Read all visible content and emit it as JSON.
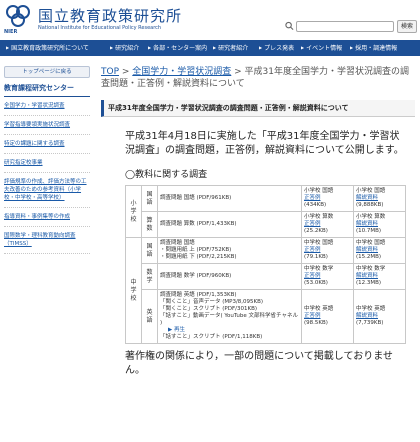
{
  "header": {
    "title": "国立教育政策研究所",
    "subtitle": "National Institute for Educational Policy Research",
    "nier": "NIER",
    "search_button": "検索"
  },
  "nav": [
    "国立教育政策研究所について",
    "研究紹介",
    "各部・センター案内",
    "研究者紹介",
    "プレス発表",
    "イベント情報",
    "採用・調達情報"
  ],
  "sidebar": {
    "top_button": "トップページに戻る",
    "title": "教育課程研究センター",
    "items": [
      "全国学力・学習状況調査",
      "学習指導要領実施状況調査",
      "特定の課題に関する調査",
      "研究指定校事業",
      "評価規準の作成、評価方法等の工夫改善のための参考資料（小学校・中学校・高等学校）",
      "指導資料・事例集等の作成",
      "国際数学・理科教育動向調査（TIMSS）"
    ]
  },
  "breadcrumb": {
    "top": "TOP",
    "sep": " > ",
    "parent": "全国学力・学習状況調査",
    "current": " > 平成31年度全国学力・学習状況調査の調査問題・正答例・解説資料について"
  },
  "page_heading": "平成31年度全国学力・学習状況調査の調査問題・正答例・解説資料について",
  "intro": "平成31年4月18日に実施した「平成31年度全国学力・学習状況調査」の調査問題，正答例，解説資料について公開します。",
  "section_heading": "◯教科に関する調査",
  "table": {
    "elementary": "小学校",
    "junior": "中学校",
    "rows": [
      {
        "subject": "国語",
        "lines": [
          "調査問題 国語 (PDF/961KB)"
        ],
        "answer": [
          "小学校 国語",
          "正答例",
          "(434KB)"
        ],
        "guide": [
          "小学校 国語",
          "解説資料",
          "(9,888KB)"
        ]
      },
      {
        "subject": "算数",
        "lines": [
          "調査問題 算数 (PDF/1,433KB)"
        ],
        "answer": [
          "小学校 算数",
          "正答例",
          "(25.2KB)"
        ],
        "guide": [
          "小学校 算数",
          "解説資料",
          "(10.7MB)"
        ]
      },
      {
        "subject": "国語",
        "lines": [
          "調査問題 国語",
          "・問題用紙 上 (PDF/752KB)",
          "・問題用紙 下 (PDF/2,215KB)"
        ],
        "answer": [
          "中学校 国語",
          "正答例",
          "(79.1KB)"
        ],
        "guide": [
          "中学校 国語",
          "解説資料",
          "(15.2MB)"
        ]
      },
      {
        "subject": "数学",
        "lines": [
          "調査問題 数学 (PDF/960KB)"
        ],
        "answer": [
          "中学校 数学",
          "正答例",
          "(53.0KB)"
        ],
        "guide": [
          "中学校 数学",
          "解説資料",
          "(12.3MB)"
        ]
      },
      {
        "subject": "英語",
        "lines": [
          "調査問題 英語 (PDF/1,353KB)",
          "「聞くこと」音声データ (MP3/8,095KB)",
          "「聞くこと」スクリプト (PDF/301KB)",
          "「話すこと」動画データ( YouTube 文部科学省チャネル )",
          "▶ 再生",
          "「話すこと」スクリプト (PDF/1,118KB)"
        ],
        "answer": [
          "中学校 英語",
          "正答例",
          "(98.5KB)"
        ],
        "guide": [
          "中学校 英語",
          "解説資料",
          "(7,739KB)"
        ]
      }
    ]
  },
  "footnote": "著作権の関係により，一部の問題について掲載しておりません。",
  "colors": {
    "brand": "#1d4f95",
    "link": "#1a5aa8"
  }
}
